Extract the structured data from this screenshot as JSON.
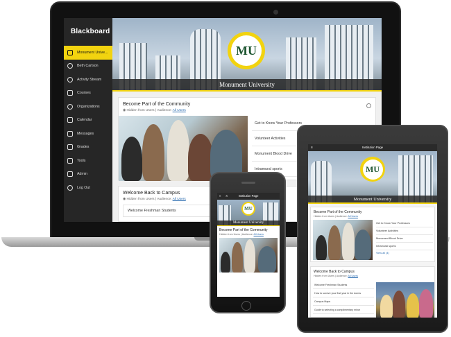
{
  "laptop": {
    "brand": "Blackboard",
    "nav": [
      {
        "label": "Monument Unive...",
        "icon": "institution-icon",
        "active": true
      },
      {
        "label": "Beth Carlson",
        "icon": "user-icon"
      },
      {
        "label": "Activity Stream",
        "icon": "globe-icon"
      },
      {
        "label": "Courses",
        "icon": "courses-icon"
      },
      {
        "label": "Organizations",
        "icon": "organizations-icon"
      },
      {
        "label": "Calendar",
        "icon": "calendar-icon"
      },
      {
        "label": "Messages",
        "icon": "messages-icon"
      },
      {
        "label": "Grades",
        "icon": "grades-icon"
      },
      {
        "label": "Tools",
        "icon": "tools-icon"
      },
      {
        "label": "Admin",
        "icon": "admin-icon"
      },
      {
        "label": "Log Out",
        "icon": "logout-icon"
      }
    ],
    "hero_title": "Monument University",
    "seal_text": "MU",
    "community": {
      "title": "Become Part of the Community",
      "visibility": "Hidden from Users",
      "audience_label": "Audience:",
      "audience_value": "All Users",
      "links": [
        "Get to Know Your Professors",
        "Volunteer Activities",
        "Monument Blood Drive",
        "Intramural sports"
      ]
    },
    "welcome": {
      "title": "Welcome Back to Campus",
      "visibility": "Hidden from Users",
      "audience_label": "Audience:",
      "audience_value": "All Users",
      "items": [
        "Welcome Freshman Students"
      ]
    }
  },
  "phone": {
    "page_title": "Institution Page",
    "hero_title": "Monument University",
    "card_title": "Become Part of the Community",
    "visibility": "Hidden from Users",
    "audience_label": "Audience:",
    "audience_value": "All Users"
  },
  "tablet": {
    "page_title": "Institution Page",
    "hero_title": "Monument University",
    "community": {
      "title": "Become Part of the Community",
      "visibility": "Hidden from Users",
      "audience_label": "Audience:",
      "audience_value": "All Users",
      "links": [
        "Get to Know Your Professors",
        "Volunteer Activities",
        "Monument Blood Drive",
        "Intramural sports"
      ],
      "view_all": "View all (4)"
    },
    "welcome": {
      "title": "Welcome Back to Campus",
      "visibility": "Hidden from Users",
      "audience_label": "Audience:",
      "audience_value": "All Users",
      "items": [
        "Welcome Freshman Students",
        "How to survive your first year in the dorms",
        "Campus Maps",
        "Guide to selecting a complimentary minor"
      ]
    }
  },
  "colors": {
    "accent": "#f2d30f",
    "sidebar": "#262626",
    "seal_green": "#1e5631",
    "link": "#2b6cb0"
  }
}
